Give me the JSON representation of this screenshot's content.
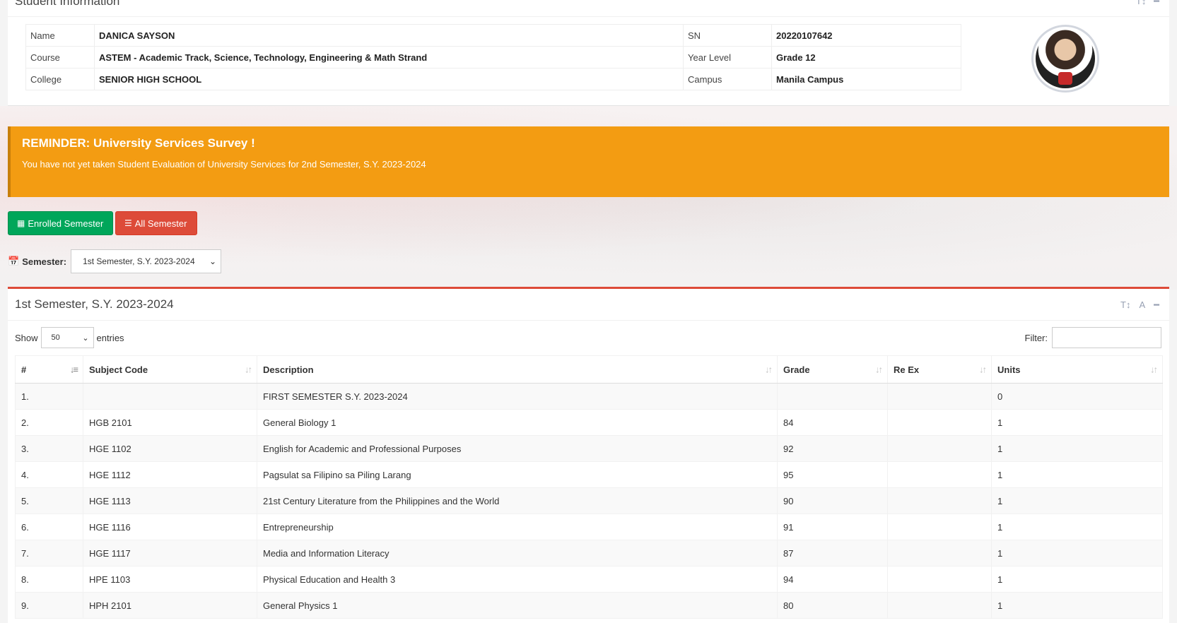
{
  "student_info": {
    "title": "Student Information",
    "rows": [
      {
        "label1": "Name",
        "value1": "DANICA SAYSON",
        "label2": "SN",
        "value2": "20220107642"
      },
      {
        "label1": "Course",
        "value1": "ASTEM - Academic Track, Science, Technology, Engineering & Math Strand",
        "label2": "Year Level",
        "value2": "Grade 12"
      },
      {
        "label1": "College",
        "value1": "SENIOR HIGH SCHOOL",
        "label2": "Campus",
        "value2": "Manila Campus"
      }
    ]
  },
  "reminder": {
    "title": "REMINDER: University Services Survey !",
    "message": "You have not yet taken Student Evaluation of University Services for 2nd Semester, S.Y. 2023-2024",
    "color": "#f39c12"
  },
  "buttons": {
    "enrolled": "Enrolled Semester",
    "all": "All Semester"
  },
  "semester_filter": {
    "label": "Semester:",
    "selected": "1st Semester, S.Y. 2023-2024"
  },
  "grades": {
    "title": "1st Semester, S.Y. 2023-2024",
    "show_label": "Show",
    "entries_value": "50",
    "entries_label": "entries",
    "filter_label": "Filter:",
    "columns": [
      "#",
      "Subject Code",
      "Description",
      "Grade",
      "Re Ex",
      "Units"
    ],
    "rows": [
      [
        "1.",
        "",
        "FIRST SEMESTER S.Y. 2023-2024",
        "",
        "",
        "0"
      ],
      [
        "2.",
        "HGB 2101",
        "General Biology 1",
        "84",
        "",
        "1"
      ],
      [
        "3.",
        "HGE 1102",
        "English for Academic and Professional Purposes",
        "92",
        "",
        "1"
      ],
      [
        "4.",
        "HGE 1112",
        "Pagsulat sa Filipino sa Piling Larang",
        "95",
        "",
        "1"
      ],
      [
        "5.",
        "HGE 1113",
        "21st Century Literature from the Philippines and the World",
        "90",
        "",
        "1"
      ],
      [
        "6.",
        "HGE 1116",
        "Entrepreneurship",
        "91",
        "",
        "1"
      ],
      [
        "7.",
        "HGE 1117",
        "Media and Information Literacy",
        "87",
        "",
        "1"
      ],
      [
        "8.",
        "HPE 1103",
        "Physical Education and Health 3",
        "94",
        "",
        "1"
      ],
      [
        "9.",
        "HPH 2101",
        "General Physics 1",
        "80",
        "",
        "1"
      ]
    ]
  },
  "colors": {
    "success": "#00a65a",
    "danger": "#dd4b39",
    "warning": "#f39c12"
  }
}
